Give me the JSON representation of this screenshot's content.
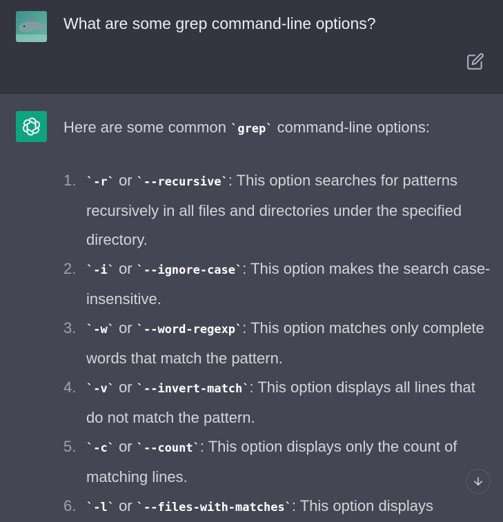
{
  "user_message": {
    "avatar_icon": "dolphin-photo-avatar",
    "text": "What are some grep command-line options?",
    "edit_icon": "edit-icon"
  },
  "assistant_message": {
    "avatar_icon": "chatgpt-logo-icon",
    "avatar_color": "#10a37f",
    "intro": {
      "before": "Here are some common ",
      "code": "`grep`",
      "after": " command-line options:"
    },
    "options": [
      {
        "number": "1.",
        "short": "`-r`",
        "or": " or ",
        "long": "`--recursive`",
        "description": ": This option searches for patterns recursively in all files and directories under the specified directory."
      },
      {
        "number": "2.",
        "short": "`-i`",
        "or": " or ",
        "long": "`--ignore-case`",
        "description": ": This option makes the search case-insensitive."
      },
      {
        "number": "3.",
        "short": "`-w`",
        "or": " or ",
        "long": "`--word-regexp`",
        "description": ": This option matches only complete words that match the pattern."
      },
      {
        "number": "4.",
        "short": "`-v`",
        "or": " or ",
        "long": "`--invert-match`",
        "description": ": This option displays all lines that do not match the pattern."
      },
      {
        "number": "5.",
        "short": "`-c`",
        "or": " or ",
        "long": "`--count`",
        "description": ": This option displays only the count of matching lines."
      },
      {
        "number": "6.",
        "short": "`-l`",
        "or": " or ",
        "long": "`--files-with-matches`",
        "description": ": This option displays"
      }
    ]
  },
  "scroll_down_icon": "arrow-down-icon",
  "colors": {
    "user_bg": "#343541",
    "assistant_bg": "#444654",
    "text": "#d1d5db",
    "accent": "#10a37f"
  }
}
